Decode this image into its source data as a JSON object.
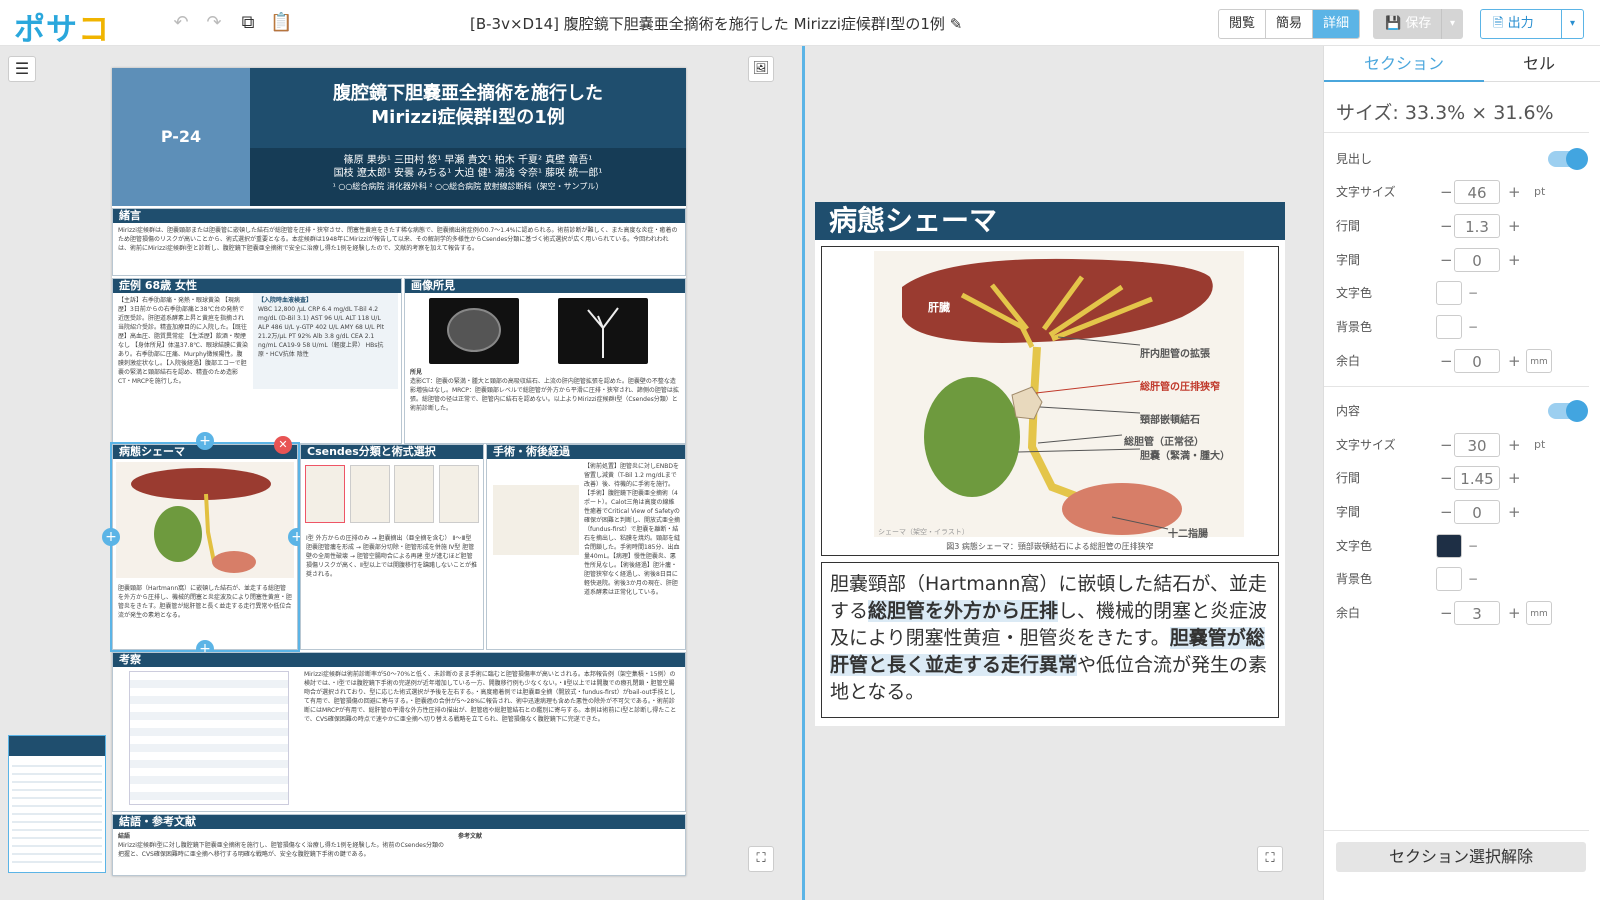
{
  "app": {
    "logo_part1": "ポサ",
    "logo_part2": "コ"
  },
  "document": {
    "title": "[B-3v×D14] 腹腔鏡下胆嚢亜全摘術を施行した Mirizzi症候群Ⅰ型の1例"
  },
  "view_modes": [
    "閲覧",
    "簡易",
    "詳細"
  ],
  "toolbar": {
    "save_label": "保存",
    "export_label": "出力"
  },
  "poster": {
    "number": "P-24",
    "title_line1": "腹腔鏡下胆嚢亜全摘術を施行した",
    "title_line2": "Mirizzi症候群Ⅰ型の1例",
    "authors_line1": "篠原 果歩¹ 三田村 悠¹ 早瀬 貴文¹ 柏木 千夏² 真壁 章吾¹",
    "authors_line2": "国枝 遼太郎¹ 安曇 みちる¹ 大迫 健¹ 湯浅 令奈¹ 藤咲 統一郎¹",
    "affiliations": "¹ ○○総合病院 消化器外科 ² ○○総合病院 放射線診断科（架空・サンプル）",
    "sections": {
      "intro": {
        "heading": "緒言",
        "body": "Mirizzi症候群は、胆嚢頸部または胆嚢管に嵌頓した結石が総胆管を圧排・狭窄させ、閉塞性黄疸をきたす稀な病態で、胆嚢摘出術症例の0.7〜1.4%に認められる。術前診断が難しく、また高度な炎症・癒着のため胆管損傷のリスクが高いことから、術式選択が重要となる。本症候群は1948年にMirizziが報告して以来、その解剖学的多様性からCsendes分類に基づく術式選択が広く用いられている。今回われわれは、術前にMirizzi症候群Ⅰ型と診断し、腹腔鏡下胆嚢亜全摘術で安全に治療し得た1例を経験したので、文献的考察を加えて報告する。"
      },
      "case": {
        "heading": "症例 68歳 女性",
        "body": "【主訴】右季肋部痛・発熱・眼球黄染 【現病歴】3日前からの右季肋部痛と38℃台の発熱で近医受診。肝胆道系酵素上昇と黄疸を指摘され当院紹介受診。精査加療目的に入院した。【既往歴】高血圧、脂質異常症 【生活歴】飲酒・喫煙なし 【身体所見】体温37.8℃、眼球結膜に黄染あり。右季肋部に圧痛、Murphy徴候陽性。腹膜刺激症状なし。【入院後経過】腹部エコーで胆嚢の緊満と頸部結石を認め、精査のため造影CT・MRCPを施行した。"
      },
      "labs": {
        "heading": "【入院時血液検査】",
        "body": "WBC 12,800 /μL CRP 6.4 mg/dL T-Bil 4.2 mg/dL (D-Bil 3.1) AST 96 U/L ALT 118 U/L ALP 486 U/L γ-GTP 402 U/L AMY 68 U/L Plt 21.2万/μL PT 92% Alb 3.8 g/dL CEA 2.1 ng/mL CA19-9 58 U/mL（軽度上昇） HBs抗原・HCV抗体 陰性"
      },
      "imaging": {
        "heading": "画像所見",
        "subheading": "所見",
        "body": "造影CT：胆嚢の緊満・腫大と頸部の高吸収結石、上流の肝内胆管拡張を認めた。胆嚢壁の不整な造影増強はなし。MRCP：胆嚢頸部レベルで総胆管が外方から平滑に圧排・狭窄され、諦側の胆管は拡張。総胆管の径は正常で、胆管内に結石を認めない。以上よりMirizzi症候群Ⅰ型（Csendes分類）と術前診断した。"
      },
      "schema": {
        "heading": "病態シェーマ",
        "body": "胆嚢頸部（Hartmann窩）に嵌頓した結石が、並走する総胆管を外方から圧排し、機械的閉塞と炎症波及により閉塞性黄疸・胆管炎をきたす。胆嚢管が総肝管と長く並走する走行異常や低位合流が発生の素地となる。"
      },
      "csendes": {
        "heading": "Csendes分類と術式選択",
        "body": "Ⅰ型 外方からの圧排のみ → 胆嚢摘出（亜全摘を含む） Ⅱ〜Ⅲ型 胆嚢胆管瘻を形成 → 胆嚢部分切除・胆管形成を併施 Ⅳ型 胆管壁の全周性破壊 → 胆管空腸吻合による再建 型が進むほど胆管損傷リスクが高く、Ⅱ型以上では開腹移行を躊躇しないことが推奨される。"
      },
      "surgery": {
        "heading": "手術・術後経過",
        "body": "【術前処置】胆管炎に対しENBDを留置し減黄（T-Bil 1.2 mg/dLまで改善）後、待機的に手術を施行。【手術】腹腔鏡下胆嚢亜全摘術（4ポート）。Calot三角は高度の線維性癒着でCritical View of Safetyの確保が困難と判断し、開放式亜全摘（fundus-first）で胆嚢を離断・結石を摘出し、粘膜を焼灼。頸部を縫合閉鎖した。手術時間185分、出血量40mL。【病理】慢性胆嚢炎、悪性所見なし。【術後経過】胆汁瘻・胆管狭窄なく経過し、術後8日目に軽快退院。術後3か月の現在、肝胆道系酵素は正常化している。"
      },
      "discussion": {
        "heading": "考察",
        "body": "Mirizzi症候群は術前診断率が50〜70%と低く、未診断のまま手術に臨むと胆管損傷率が高いとされる。本邦報告例（架空集積・15例）の検討では、・Ⅰ型では腹腔鏡下手術の完遂例が近年増加している一方、開腹移行例も少なくない。・Ⅱ型以上では開腹での療孔閉鎖・胆管空腸吻合が選択されており、型に応じた術式選択が予後を左右する。・高度癒着例では胆嚢亜全摘（開放式・fundus-first）がbail-out手技として有用で、胆管損傷の回避に寄与する。・胆嚢癌の合併が5〜28%に報告され、術中迅速病理も含めた悪性の除外が不可欠である。・術前診断にはMRCPが有用で、総肝管の平滑な外方性圧排の描出が、胆管癌や総胆管結石との鑑別に寄与する。本例は術前にⅠ型と診断し得たことで、CVS確保困難の時点で速やかに亜全摘へ切り替える戦略を立てられ、胆管損傷なく腹腔鏡下に完遂できた。"
      },
      "conclusion": {
        "heading": "結語・参考文献",
        "subheading": "結語",
        "body": "Mirizzi症候群Ⅰ型に対し腹腔鏡下胆嚢亜全摘術を施行し、胆管損傷なく治療し得た1例を経験した。術前のCsendes分類の把握と、CVS確保困難時に亜全摘へ移行する明確な戦略が、安全な腹腔鏡下手術の鍵である。",
        "refs_heading": "参考文献"
      }
    }
  },
  "section_detail": {
    "heading": "病態シェーマ",
    "figure_caption": "図3 病態シェーマ：頸部嵌頓結石による総胆管の圧排狭窄",
    "figure_watermark": "シェーマ（架空・イラスト）",
    "labels": {
      "liver": "肝臓",
      "intrahepatic": "肝内胆管の拡張",
      "cbd_compression": "総肝管の圧排狭窄",
      "neck_stone": "頸部嵌頓結石",
      "cbd_normal": "総胆管（正常径）",
      "gallbladder": "胆嚢（緊満・腫大）",
      "duodenum": "十二指腸"
    },
    "text_plain1": "胆嚢頸部（Hartmann窩）に嵌頓した結石が、並走する",
    "text_bold1": "総胆管を外方から圧排",
    "text_plain2": "し、機械的閉塞と炎症波及により閉塞性黄疸・胆管炎をきたす。",
    "text_bold2": "胆嚢管が総肝管と長く並走する走行異常",
    "text_plain3": "や低位合流が発生の素地となる。"
  },
  "sidebar": {
    "tabs": [
      "セクション",
      "セル"
    ],
    "size_label": "サイズ: 33.3% × 31.6%",
    "heading_group": {
      "label": "見出し",
      "font_size_label": "文字サイズ",
      "font_size": "46",
      "unit_pt": "pt",
      "line_height_label": "行間",
      "line_height": "1.3",
      "letter_spacing_label": "字間",
      "letter_spacing": "0",
      "text_color_label": "文字色",
      "bg_color_label": "背景色",
      "margin_label": "余白",
      "margin": "0",
      "unit_mm": "mm"
    },
    "content_group": {
      "label": "内容",
      "font_size_label": "文字サイズ",
      "font_size": "30",
      "unit_pt": "pt",
      "line_height_label": "行間",
      "line_height": "1.45",
      "letter_spacing_label": "字間",
      "letter_spacing": "0",
      "text_color_label": "文字色",
      "text_color": "#1e2f45",
      "bg_color_label": "背景色",
      "margin_label": "余白",
      "margin": "3",
      "unit_mm": "mm"
    },
    "clear_selection": "セクション選択解除"
  }
}
